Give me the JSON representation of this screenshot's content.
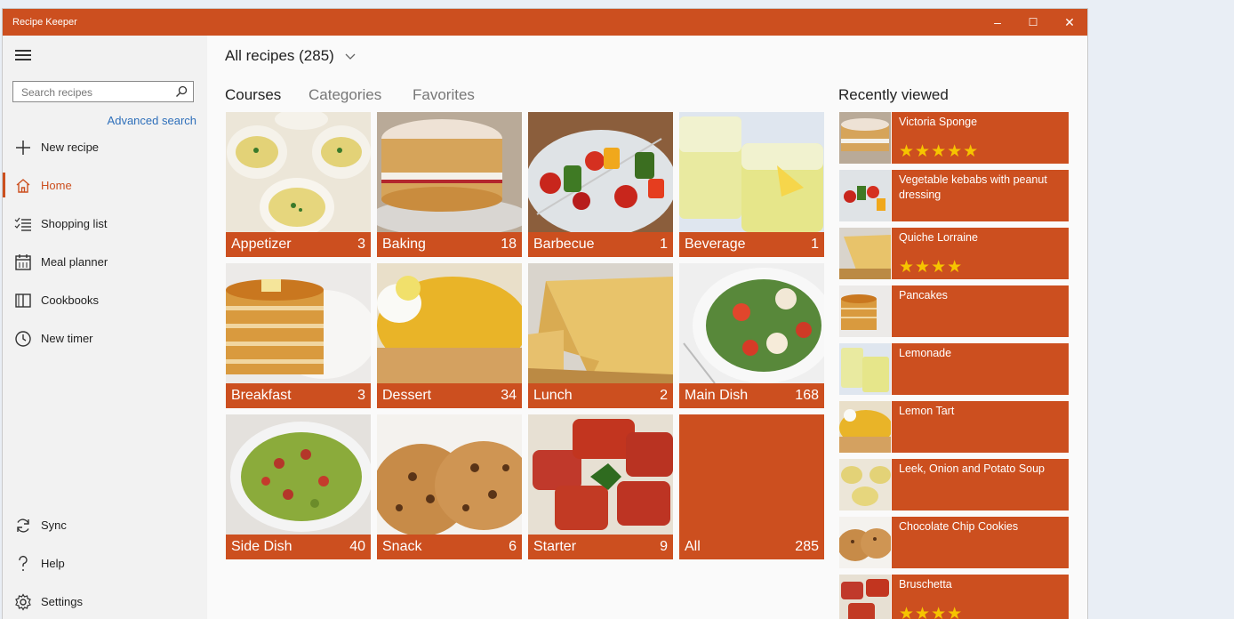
{
  "app": {
    "title": "Recipe Keeper"
  },
  "window_controls": {
    "minimize": "–",
    "maximize": "☐",
    "close": "✕"
  },
  "sidebar": {
    "search_placeholder": "Search recipes",
    "advanced_search": "Advanced search",
    "items": [
      {
        "label": "New recipe",
        "icon": "plus-icon"
      },
      {
        "label": "Home",
        "icon": "home-icon",
        "active": true
      },
      {
        "label": "Shopping list",
        "icon": "checklist-icon"
      },
      {
        "label": "Meal planner",
        "icon": "calendar-icon"
      },
      {
        "label": "Cookbooks",
        "icon": "book-icon"
      },
      {
        "label": "New timer",
        "icon": "clock-icon"
      }
    ],
    "bottom_items": [
      {
        "label": "Sync",
        "icon": "sync-icon"
      },
      {
        "label": "Help",
        "icon": "help-icon"
      },
      {
        "label": "Settings",
        "icon": "gear-icon"
      }
    ]
  },
  "header": {
    "title": "All recipes (285)"
  },
  "tabs": [
    {
      "label": "Courses",
      "active": true
    },
    {
      "label": "Categories",
      "active": false
    },
    {
      "label": "Favorites",
      "active": false
    }
  ],
  "courses": [
    {
      "name": "Appetizer",
      "count": "3",
      "image": "soup-bowls"
    },
    {
      "name": "Baking",
      "count": "18",
      "image": "sponge-cake"
    },
    {
      "name": "Barbecue",
      "count": "1",
      "image": "vegetable-kebabs"
    },
    {
      "name": "Beverage",
      "count": "1",
      "image": "lemonade-glasses"
    },
    {
      "name": "Breakfast",
      "count": "3",
      "image": "pancakes"
    },
    {
      "name": "Dessert",
      "count": "34",
      "image": "lemon-tart"
    },
    {
      "name": "Lunch",
      "count": "2",
      "image": "quiche"
    },
    {
      "name": "Main Dish",
      "count": "168",
      "image": "salad-plate"
    },
    {
      "name": "Side Dish",
      "count": "40",
      "image": "bean-salad"
    },
    {
      "name": "Snack",
      "count": "6",
      "image": "cookies"
    },
    {
      "name": "Starter",
      "count": "9",
      "image": "bruschetta"
    },
    {
      "name": "All",
      "count": "285",
      "image": "none"
    }
  ],
  "recent": {
    "title": "Recently viewed",
    "items": [
      {
        "name": "Victoria Sponge",
        "stars": "★★★★★",
        "image": "sponge-cake"
      },
      {
        "name": "Vegetable kebabs with peanut dressing",
        "stars": "",
        "image": "vegetable-kebabs"
      },
      {
        "name": "Quiche Lorraine",
        "stars": "★★★★",
        "image": "quiche"
      },
      {
        "name": "Pancakes",
        "stars": "",
        "image": "pancakes"
      },
      {
        "name": "Lemonade",
        "stars": "",
        "image": "lemonade-glasses"
      },
      {
        "name": "Lemon Tart",
        "stars": "",
        "image": "lemon-tart"
      },
      {
        "name": "Leek, Onion and Potato Soup",
        "stars": "",
        "image": "soup-bowls"
      },
      {
        "name": "Chocolate Chip Cookies",
        "stars": "",
        "image": "cookies"
      },
      {
        "name": "Bruschetta",
        "stars": "★★★★",
        "image": "bruschetta"
      }
    ]
  },
  "colors": {
    "accent": "#cc4f1f",
    "star": "#f6c400",
    "link": "#2e6fba"
  }
}
